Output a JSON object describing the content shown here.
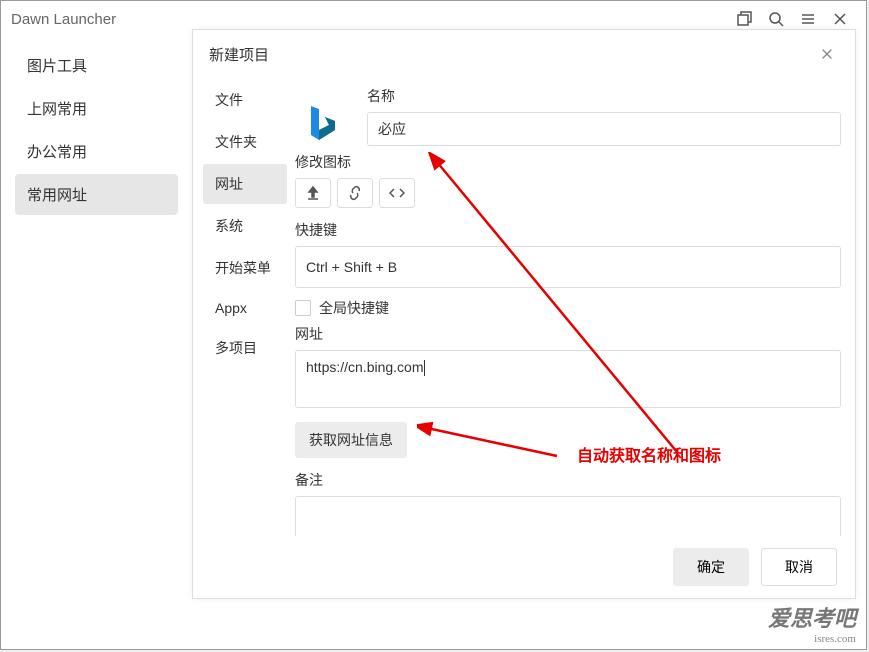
{
  "window": {
    "title": "Dawn Launcher"
  },
  "sidebar": {
    "items": [
      {
        "label": "图片工具",
        "active": false
      },
      {
        "label": "上网常用",
        "active": false
      },
      {
        "label": "办公常用",
        "active": false
      },
      {
        "label": "常用网址",
        "active": true
      }
    ]
  },
  "dialog": {
    "title": "新建项目",
    "types": [
      {
        "label": "文件",
        "active": false
      },
      {
        "label": "文件夹",
        "active": false
      },
      {
        "label": "网址",
        "active": true
      },
      {
        "label": "系统",
        "active": false
      },
      {
        "label": "开始菜单",
        "active": false
      },
      {
        "label": "Appx",
        "active": false
      },
      {
        "label": "多项目",
        "active": false
      }
    ],
    "name_label": "名称",
    "name_value": "必应",
    "icon_label": "修改图标",
    "hotkey_label": "快捷键",
    "hotkey_value": "Ctrl + Shift + B",
    "global_hotkey_label": "全局快捷键",
    "url_label": "网址",
    "url_value": "https://cn.bing.com",
    "fetch_label": "获取网址信息",
    "remark_label": "备注",
    "ok_label": "确定",
    "cancel_label": "取消"
  },
  "annotation": {
    "text": "自动获取名称和图标"
  },
  "watermark": {
    "big": "爱思考吧",
    "small": "isres.com"
  }
}
